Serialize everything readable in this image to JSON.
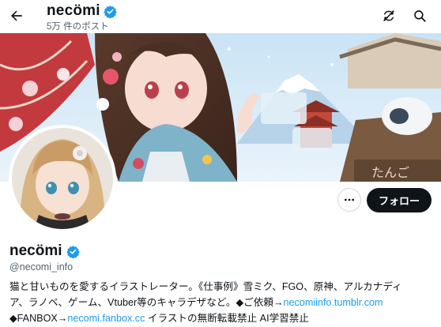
{
  "header": {
    "name": "necömi",
    "post_count": "5万 件のポスト"
  },
  "profile": {
    "name": "necömi",
    "handle": "@necomi_info",
    "follow_label": "フォロー"
  },
  "bio": {
    "line1": "猫と甘いものを愛するイラストレーター。《仕事例》雪ミク、FGO、原神、アルカナディ",
    "line2_text": "ア、ラノベ、ゲーム、Vtuber等のキャラデザなど。◆ご依頼→",
    "line2_link": "necomiinfo.tumblr.com",
    "line3_prefix": "◆FANBOX→",
    "line3_link": "necomi.fanbox.cc",
    "line3_suffix": " イラストの無断転載禁止 AI学習禁止"
  },
  "colors": {
    "verified": "#1d9bf0",
    "follow_bg": "#0f1419",
    "link": "#1d9bf0"
  },
  "icons": {
    "back": "arrow-left-icon",
    "refresh": "slashed-refresh-icon",
    "search": "search-icon",
    "more": "more-dots-icon",
    "verified": "verified-badge-icon"
  }
}
